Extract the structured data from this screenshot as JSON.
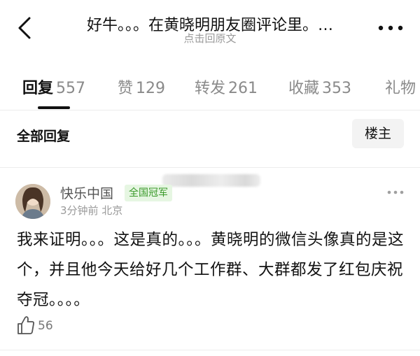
{
  "header": {
    "title": "好牛。。。在黄晓明朋友圈评论里。…",
    "subtitle": "点击回原文"
  },
  "tabs": [
    {
      "label": "回复",
      "count": "557",
      "active": true
    },
    {
      "label": "赞",
      "count": "129",
      "active": false
    },
    {
      "label": "转发",
      "count": "261",
      "active": false
    },
    {
      "label": "收藏",
      "count": "353",
      "active": false
    },
    {
      "label": "礼物",
      "count": "",
      "active": false
    }
  ],
  "filter": {
    "all_replies": "全部回复",
    "op_button": "楼主"
  },
  "comment": {
    "username": "快乐中国",
    "badge": "全国冠军",
    "meta": "3分钟前 北京",
    "body": "我来证明。。。这是真的。。。黄晓明的微信头像真的是这个，并且他今天给好几个工作群、大群都发了红包庆祝夺冠。。。。",
    "likes": "56"
  },
  "colors": {
    "badge_bg": "#e6f6e2",
    "badge_text": "#3a9a2a",
    "muted_text": "#9a9a9a"
  }
}
